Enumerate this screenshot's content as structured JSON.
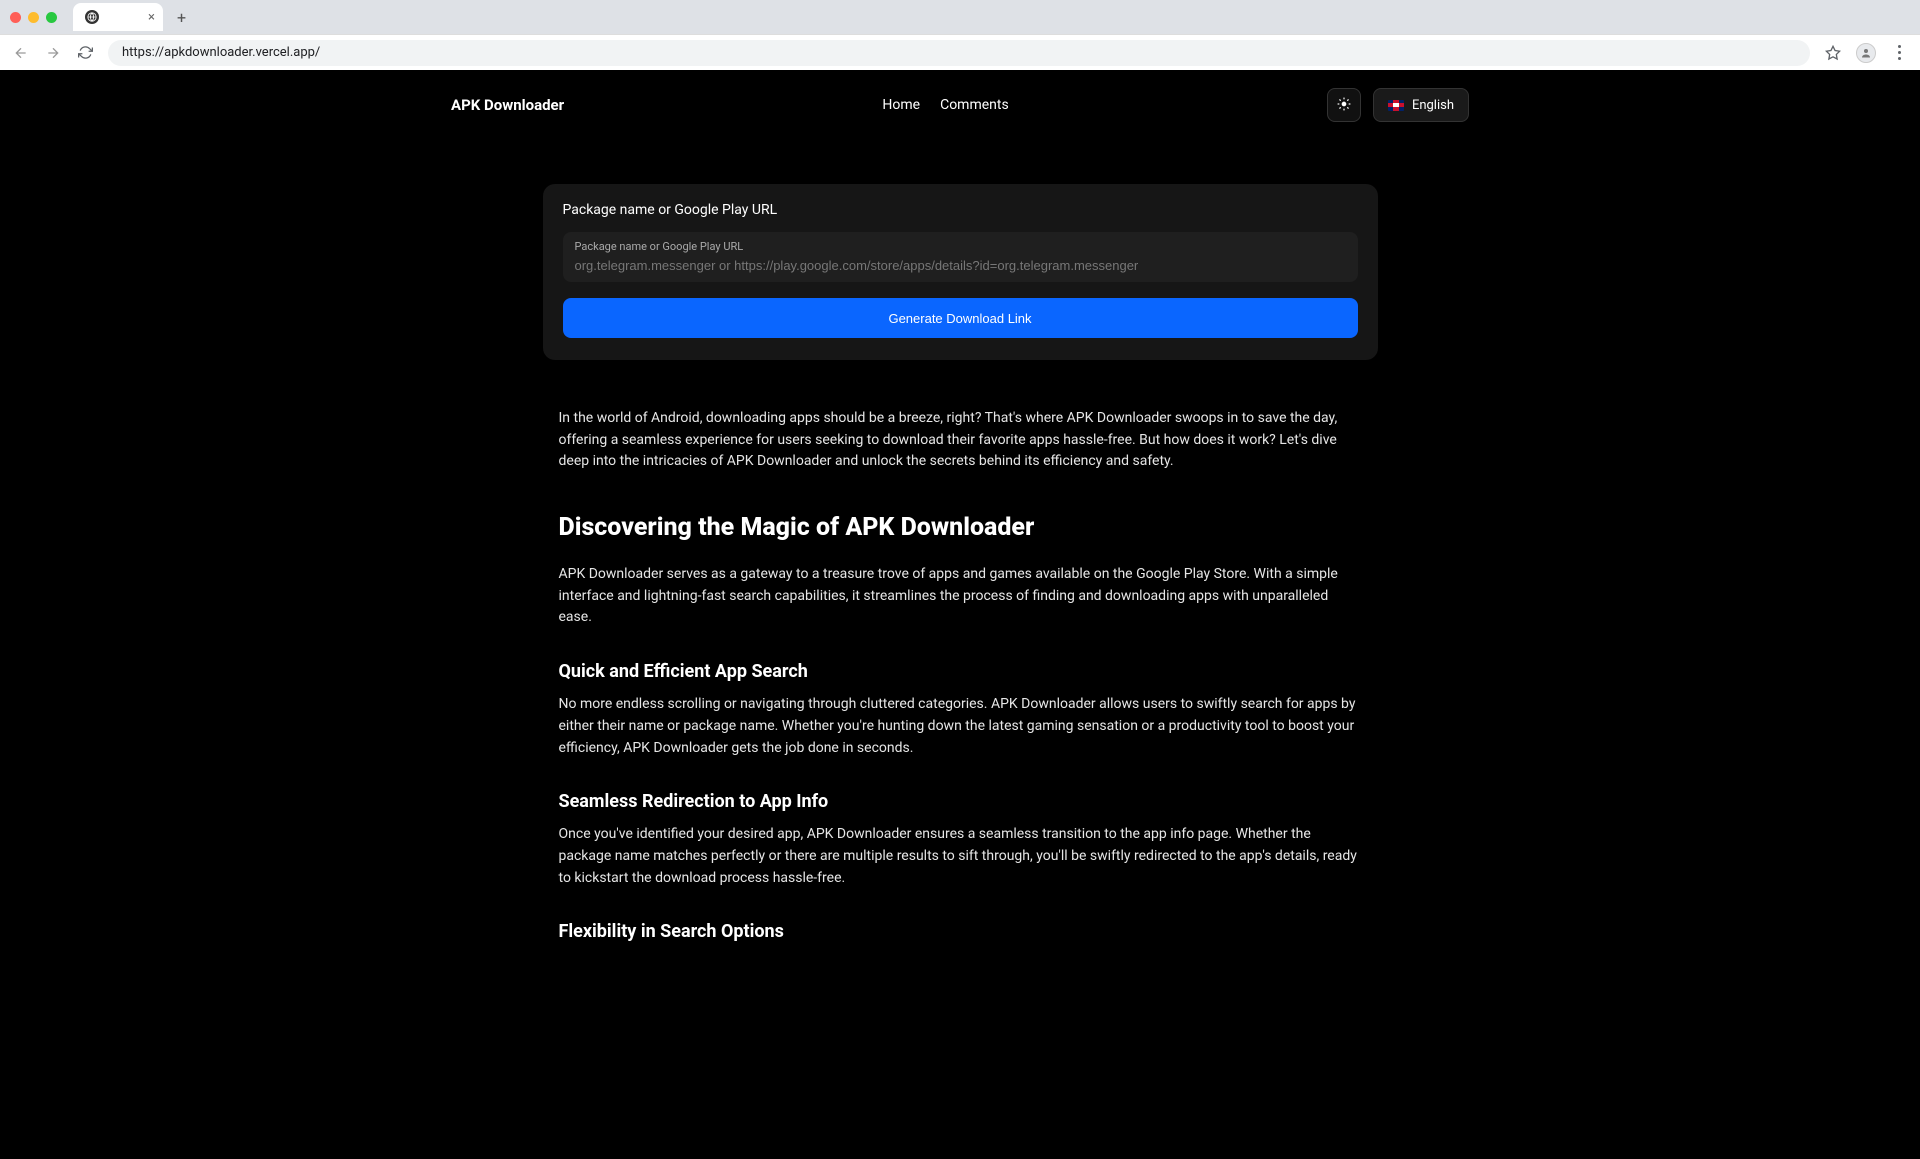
{
  "browser": {
    "url": "https://apkdownloader.vercel.app/",
    "tab_title": ""
  },
  "nav": {
    "brand": "APK Downloader",
    "home": "Home",
    "comments": "Comments",
    "language": "English"
  },
  "card": {
    "title": "Package name or Google Play URL",
    "input_label": "Package name or Google Play URL",
    "placeholder": "org.telegram.messenger or https://play.google.com/store/apps/details?id=org.telegram.messenger",
    "button": "Generate Download Link"
  },
  "content": {
    "intro": "In the world of Android, downloading apps should be a breeze, right? That's where APK Downloader swoops in to save the day, offering a seamless experience for users seeking to download their favorite apps hassle-free. But how does it work? Let's dive deep into the intricacies of APK Downloader and unlock the secrets behind its efficiency and safety.",
    "h2_discovering": "Discovering the Magic of APK Downloader",
    "p_discovering": "APK Downloader serves as a gateway to a treasure trove of apps and games available on the Google Play Store. With a simple interface and lightning-fast search capabilities, it streamlines the process of finding and downloading apps with unparalleled ease.",
    "h3_quick": "Quick and Efficient App Search",
    "p_quick": "No more endless scrolling or navigating through cluttered categories. APK Downloader allows users to swiftly search for apps by either their name or package name. Whether you're hunting down the latest gaming sensation or a productivity tool to boost your efficiency, APK Downloader gets the job done in seconds.",
    "h3_seamless": "Seamless Redirection to App Info",
    "p_seamless": "Once you've identified your desired app, APK Downloader ensures a seamless transition to the app info page. Whether the package name matches perfectly or there are multiple results to sift through, you'll be swiftly redirected to the app's details, ready to kickstart the download process hassle-free.",
    "h3_flex": "Flexibility in Search Options"
  }
}
